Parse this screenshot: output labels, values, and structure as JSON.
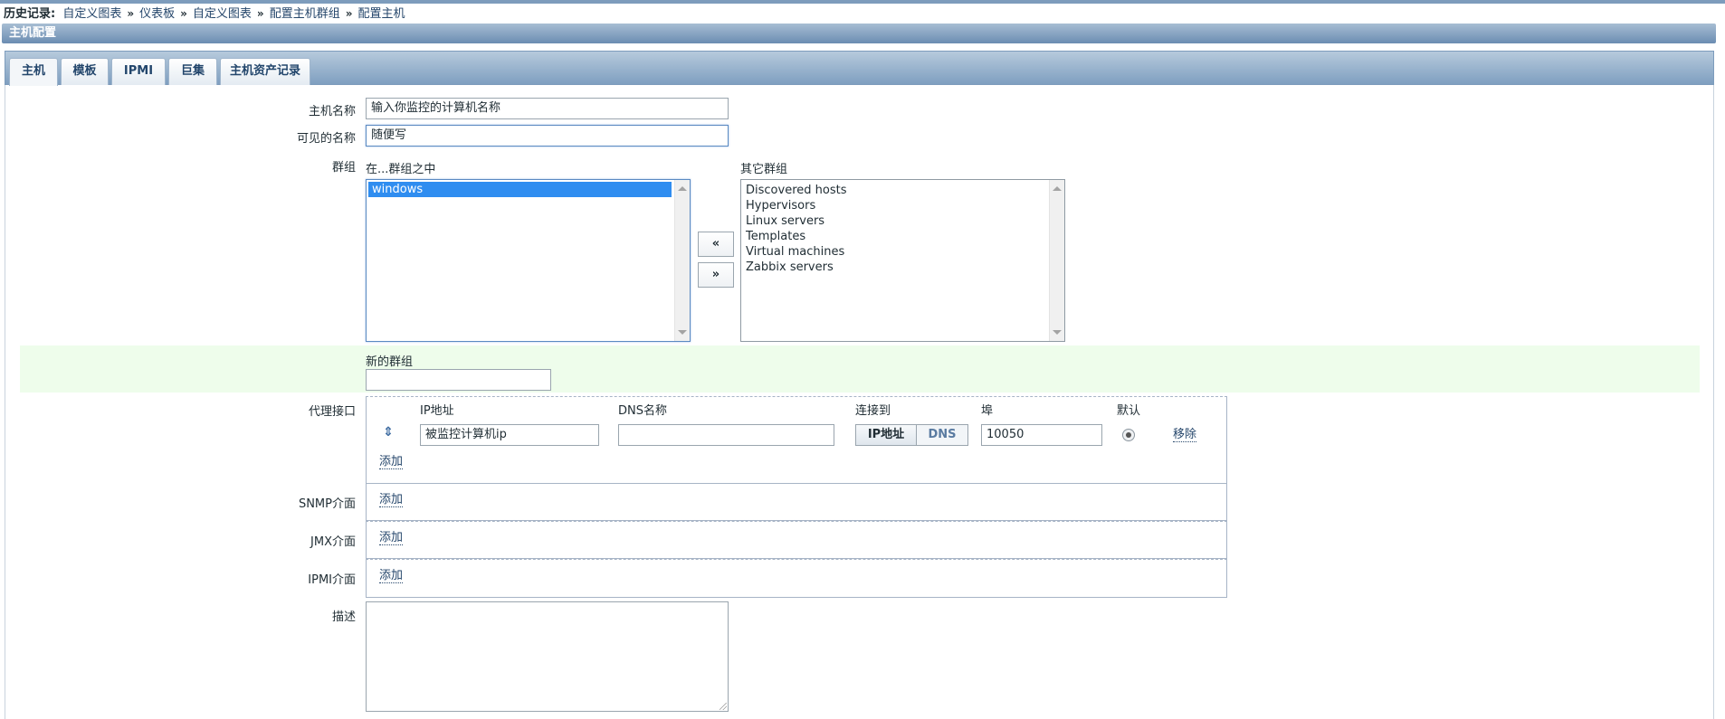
{
  "history": {
    "label": "历史记录:",
    "items": [
      "自定义图表",
      "仪表板",
      "自定义图表",
      "配置主机群组",
      "配置主机"
    ],
    "separator": "»"
  },
  "header": {
    "title": "主机配置"
  },
  "tabs": [
    {
      "label": "主机",
      "active": true
    },
    {
      "label": "模板",
      "active": false
    },
    {
      "label": "IPMI",
      "active": false
    },
    {
      "label": "巨集",
      "active": false
    },
    {
      "label": "主机资产记录",
      "active": false
    }
  ],
  "form": {
    "host_name_label": "主机名称",
    "host_name_value": "输入你监控的计算机名称",
    "visible_name_label": "可见的名称",
    "visible_name_value": "随便写",
    "groups_label": "群组",
    "in_groups_header": "在...群组之中",
    "in_groups": [
      "windows"
    ],
    "other_groups_header": "其它群组",
    "other_groups": [
      "Discovered hosts",
      "Hypervisors",
      "Linux servers",
      "Templates",
      "Virtual machines",
      "Zabbix servers"
    ],
    "move_left": "«",
    "move_right": "»",
    "new_group_label": "新的群组",
    "new_group_value": "",
    "agent_iface_label": "代理接口",
    "col_ip": "IP地址",
    "col_dns": "DNS名称",
    "col_connect": "连接到",
    "col_port": "埠",
    "col_default": "默认",
    "agent_ip_value": "被监控计算机ip",
    "agent_dns_value": "",
    "connect_ip": "IP地址",
    "connect_dns": "DNS",
    "port_value": "10050",
    "remove_link": "移除",
    "add_link": "添加",
    "snmp_label": "SNMP介面",
    "jmx_label": "JMX介面",
    "ipmi_label": "IPMI介面",
    "description_label": "描述",
    "description_value": ""
  }
}
